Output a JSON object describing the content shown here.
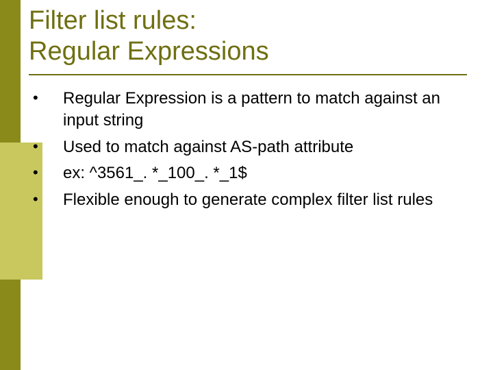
{
  "title_line1": "Filter list rules:",
  "title_line2": "Regular Expressions",
  "bullets": [
    "Regular Expression is a pattern to match against an input string",
    "Used to match against AS-path attribute",
    "ex: ^3561_. *_100_. *_1$",
    "Flexible enough to generate complex filter list rules"
  ]
}
